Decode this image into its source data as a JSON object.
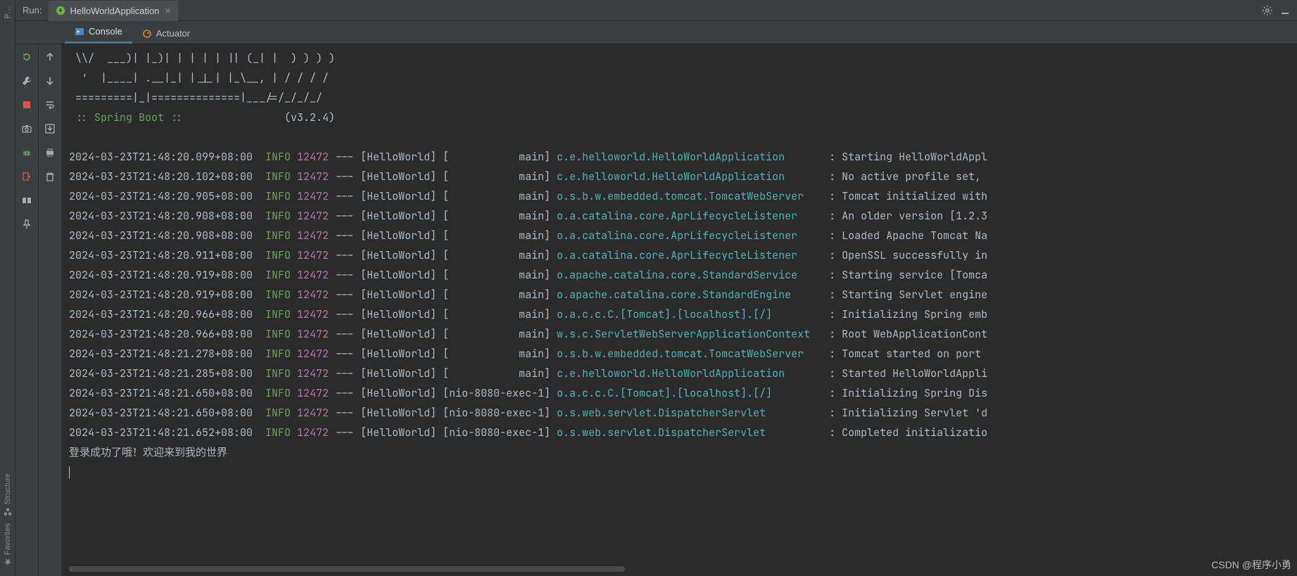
{
  "header": {
    "run_label": "Run:",
    "tab_name": "HelloWorldApplication",
    "close_glyph": "×"
  },
  "tabs": {
    "console": "Console",
    "actuator": "Actuator"
  },
  "far_left": {
    "project": "P…",
    "structure": "Structure",
    "favorites": "Favorites"
  },
  "banner": [
    " \\\\/  ___)| |_)| | | | | || (_| |  ) ) ) )",
    "  '  |____| .__|_| |_|_| |_\\__, | / / / /",
    " =========|_|==============|___/=/_/_/_/"
  ],
  "boot_line": {
    "label": " :: Spring Boot :: ",
    "version": "(v3.2.4)"
  },
  "log_cols": {
    "sep": " --- ",
    "app": "[HelloWorld]",
    "colon": " : "
  },
  "logs": [
    {
      "ts": "2024-03-23T21:48:20.099+08:00",
      "lvl": "INFO",
      "pid": "12472",
      "thr": "[           main]",
      "src": "c.e.helloworld.HelloWorldApplication      ",
      "msg": "Starting HelloWorldAppl"
    },
    {
      "ts": "2024-03-23T21:48:20.102+08:00",
      "lvl": "INFO",
      "pid": "12472",
      "thr": "[           main]",
      "src": "c.e.helloworld.HelloWorldApplication      ",
      "msg": "No active profile set, "
    },
    {
      "ts": "2024-03-23T21:48:20.905+08:00",
      "lvl": "INFO",
      "pid": "12472",
      "thr": "[           main]",
      "src": "o.s.b.w.embedded.tomcat.TomcatWebServer   ",
      "msg": "Tomcat initialized with"
    },
    {
      "ts": "2024-03-23T21:48:20.908+08:00",
      "lvl": "INFO",
      "pid": "12472",
      "thr": "[           main]",
      "src": "o.a.catalina.core.AprLifecycleListener    ",
      "msg": "An older version [1.2.3"
    },
    {
      "ts": "2024-03-23T21:48:20.908+08:00",
      "lvl": "INFO",
      "pid": "12472",
      "thr": "[           main]",
      "src": "o.a.catalina.core.AprLifecycleListener    ",
      "msg": "Loaded Apache Tomcat Na"
    },
    {
      "ts": "2024-03-23T21:48:20.911+08:00",
      "lvl": "INFO",
      "pid": "12472",
      "thr": "[           main]",
      "src": "o.a.catalina.core.AprLifecycleListener    ",
      "msg": "OpenSSL successfully in"
    },
    {
      "ts": "2024-03-23T21:48:20.919+08:00",
      "lvl": "INFO",
      "pid": "12472",
      "thr": "[           main]",
      "src": "o.apache.catalina.core.StandardService    ",
      "msg": "Starting service [Tomca"
    },
    {
      "ts": "2024-03-23T21:48:20.919+08:00",
      "lvl": "INFO",
      "pid": "12472",
      "thr": "[           main]",
      "src": "o.apache.catalina.core.StandardEngine     ",
      "msg": "Starting Servlet engine"
    },
    {
      "ts": "2024-03-23T21:48:20.966+08:00",
      "lvl": "INFO",
      "pid": "12472",
      "thr": "[           main]",
      "src": "o.a.c.c.C.[Tomcat].[localhost].[/]        ",
      "msg": "Initializing Spring emb"
    },
    {
      "ts": "2024-03-23T21:48:20.966+08:00",
      "lvl": "INFO",
      "pid": "12472",
      "thr": "[           main]",
      "src": "w.s.c.ServletWebServerApplicationContext  ",
      "msg": "Root WebApplicationCont"
    },
    {
      "ts": "2024-03-23T21:48:21.278+08:00",
      "lvl": "INFO",
      "pid": "12472",
      "thr": "[           main]",
      "src": "o.s.b.w.embedded.tomcat.TomcatWebServer   ",
      "msg": "Tomcat started on port "
    },
    {
      "ts": "2024-03-23T21:48:21.285+08:00",
      "lvl": "INFO",
      "pid": "12472",
      "thr": "[           main]",
      "src": "c.e.helloworld.HelloWorldApplication      ",
      "msg": "Started HelloWorldAppli"
    },
    {
      "ts": "2024-03-23T21:48:21.650+08:00",
      "lvl": "INFO",
      "pid": "12472",
      "thr": "[nio-8080-exec-1]",
      "src": "o.a.c.c.C.[Tomcat].[localhost].[/]        ",
      "msg": "Initializing Spring Dis"
    },
    {
      "ts": "2024-03-23T21:48:21.650+08:00",
      "lvl": "INFO",
      "pid": "12472",
      "thr": "[nio-8080-exec-1]",
      "src": "o.s.web.servlet.DispatcherServlet         ",
      "msg": "Initializing Servlet 'd"
    },
    {
      "ts": "2024-03-23T21:48:21.652+08:00",
      "lvl": "INFO",
      "pid": "12472",
      "thr": "[nio-8080-exec-1]",
      "src": "o.s.web.servlet.DispatcherServlet         ",
      "msg": "Completed initializatio"
    }
  ],
  "tail": "登录成功了哦！欢迎来到我的世界",
  "watermark": "CSDN @程序小勇"
}
